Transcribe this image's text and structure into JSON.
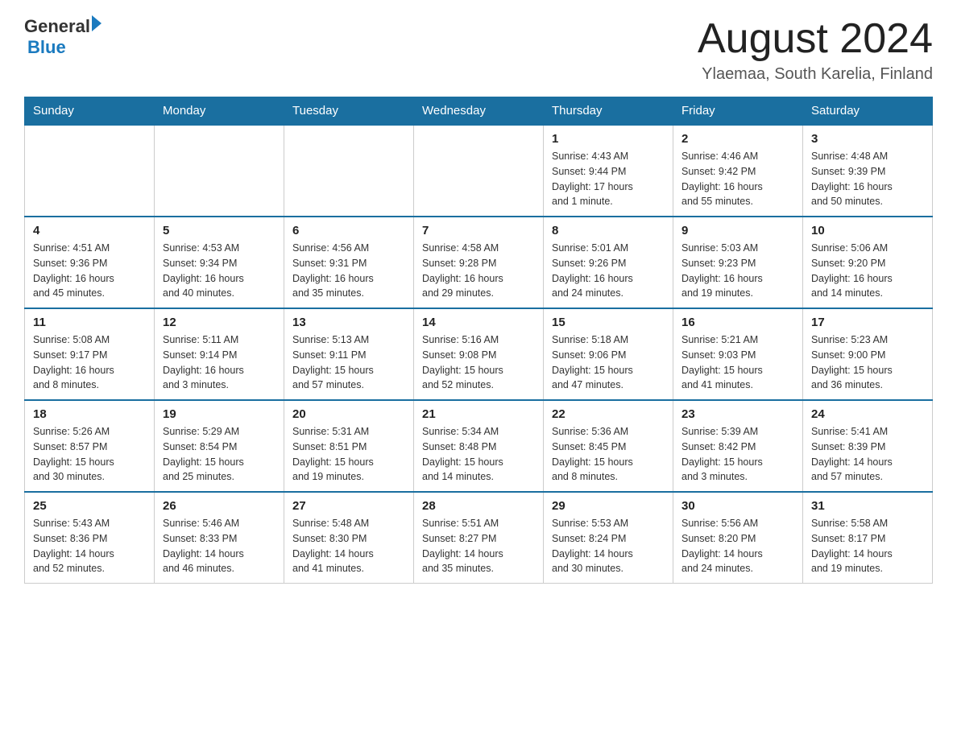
{
  "logo": {
    "general": "General",
    "blue": "Blue"
  },
  "title": "August 2024",
  "subtitle": "Ylaemaa, South Karelia, Finland",
  "days_header": [
    "Sunday",
    "Monday",
    "Tuesday",
    "Wednesday",
    "Thursday",
    "Friday",
    "Saturday"
  ],
  "weeks": [
    [
      {
        "day": "",
        "info": ""
      },
      {
        "day": "",
        "info": ""
      },
      {
        "day": "",
        "info": ""
      },
      {
        "day": "",
        "info": ""
      },
      {
        "day": "1",
        "info": "Sunrise: 4:43 AM\nSunset: 9:44 PM\nDaylight: 17 hours\nand 1 minute."
      },
      {
        "day": "2",
        "info": "Sunrise: 4:46 AM\nSunset: 9:42 PM\nDaylight: 16 hours\nand 55 minutes."
      },
      {
        "day": "3",
        "info": "Sunrise: 4:48 AM\nSunset: 9:39 PM\nDaylight: 16 hours\nand 50 minutes."
      }
    ],
    [
      {
        "day": "4",
        "info": "Sunrise: 4:51 AM\nSunset: 9:36 PM\nDaylight: 16 hours\nand 45 minutes."
      },
      {
        "day": "5",
        "info": "Sunrise: 4:53 AM\nSunset: 9:34 PM\nDaylight: 16 hours\nand 40 minutes."
      },
      {
        "day": "6",
        "info": "Sunrise: 4:56 AM\nSunset: 9:31 PM\nDaylight: 16 hours\nand 35 minutes."
      },
      {
        "day": "7",
        "info": "Sunrise: 4:58 AM\nSunset: 9:28 PM\nDaylight: 16 hours\nand 29 minutes."
      },
      {
        "day": "8",
        "info": "Sunrise: 5:01 AM\nSunset: 9:26 PM\nDaylight: 16 hours\nand 24 minutes."
      },
      {
        "day": "9",
        "info": "Sunrise: 5:03 AM\nSunset: 9:23 PM\nDaylight: 16 hours\nand 19 minutes."
      },
      {
        "day": "10",
        "info": "Sunrise: 5:06 AM\nSunset: 9:20 PM\nDaylight: 16 hours\nand 14 minutes."
      }
    ],
    [
      {
        "day": "11",
        "info": "Sunrise: 5:08 AM\nSunset: 9:17 PM\nDaylight: 16 hours\nand 8 minutes."
      },
      {
        "day": "12",
        "info": "Sunrise: 5:11 AM\nSunset: 9:14 PM\nDaylight: 16 hours\nand 3 minutes."
      },
      {
        "day": "13",
        "info": "Sunrise: 5:13 AM\nSunset: 9:11 PM\nDaylight: 15 hours\nand 57 minutes."
      },
      {
        "day": "14",
        "info": "Sunrise: 5:16 AM\nSunset: 9:08 PM\nDaylight: 15 hours\nand 52 minutes."
      },
      {
        "day": "15",
        "info": "Sunrise: 5:18 AM\nSunset: 9:06 PM\nDaylight: 15 hours\nand 47 minutes."
      },
      {
        "day": "16",
        "info": "Sunrise: 5:21 AM\nSunset: 9:03 PM\nDaylight: 15 hours\nand 41 minutes."
      },
      {
        "day": "17",
        "info": "Sunrise: 5:23 AM\nSunset: 9:00 PM\nDaylight: 15 hours\nand 36 minutes."
      }
    ],
    [
      {
        "day": "18",
        "info": "Sunrise: 5:26 AM\nSunset: 8:57 PM\nDaylight: 15 hours\nand 30 minutes."
      },
      {
        "day": "19",
        "info": "Sunrise: 5:29 AM\nSunset: 8:54 PM\nDaylight: 15 hours\nand 25 minutes."
      },
      {
        "day": "20",
        "info": "Sunrise: 5:31 AM\nSunset: 8:51 PM\nDaylight: 15 hours\nand 19 minutes."
      },
      {
        "day": "21",
        "info": "Sunrise: 5:34 AM\nSunset: 8:48 PM\nDaylight: 15 hours\nand 14 minutes."
      },
      {
        "day": "22",
        "info": "Sunrise: 5:36 AM\nSunset: 8:45 PM\nDaylight: 15 hours\nand 8 minutes."
      },
      {
        "day": "23",
        "info": "Sunrise: 5:39 AM\nSunset: 8:42 PM\nDaylight: 15 hours\nand 3 minutes."
      },
      {
        "day": "24",
        "info": "Sunrise: 5:41 AM\nSunset: 8:39 PM\nDaylight: 14 hours\nand 57 minutes."
      }
    ],
    [
      {
        "day": "25",
        "info": "Sunrise: 5:43 AM\nSunset: 8:36 PM\nDaylight: 14 hours\nand 52 minutes."
      },
      {
        "day": "26",
        "info": "Sunrise: 5:46 AM\nSunset: 8:33 PM\nDaylight: 14 hours\nand 46 minutes."
      },
      {
        "day": "27",
        "info": "Sunrise: 5:48 AM\nSunset: 8:30 PM\nDaylight: 14 hours\nand 41 minutes."
      },
      {
        "day": "28",
        "info": "Sunrise: 5:51 AM\nSunset: 8:27 PM\nDaylight: 14 hours\nand 35 minutes."
      },
      {
        "day": "29",
        "info": "Sunrise: 5:53 AM\nSunset: 8:24 PM\nDaylight: 14 hours\nand 30 minutes."
      },
      {
        "day": "30",
        "info": "Sunrise: 5:56 AM\nSunset: 8:20 PM\nDaylight: 14 hours\nand 24 minutes."
      },
      {
        "day": "31",
        "info": "Sunrise: 5:58 AM\nSunset: 8:17 PM\nDaylight: 14 hours\nand 19 minutes."
      }
    ]
  ]
}
